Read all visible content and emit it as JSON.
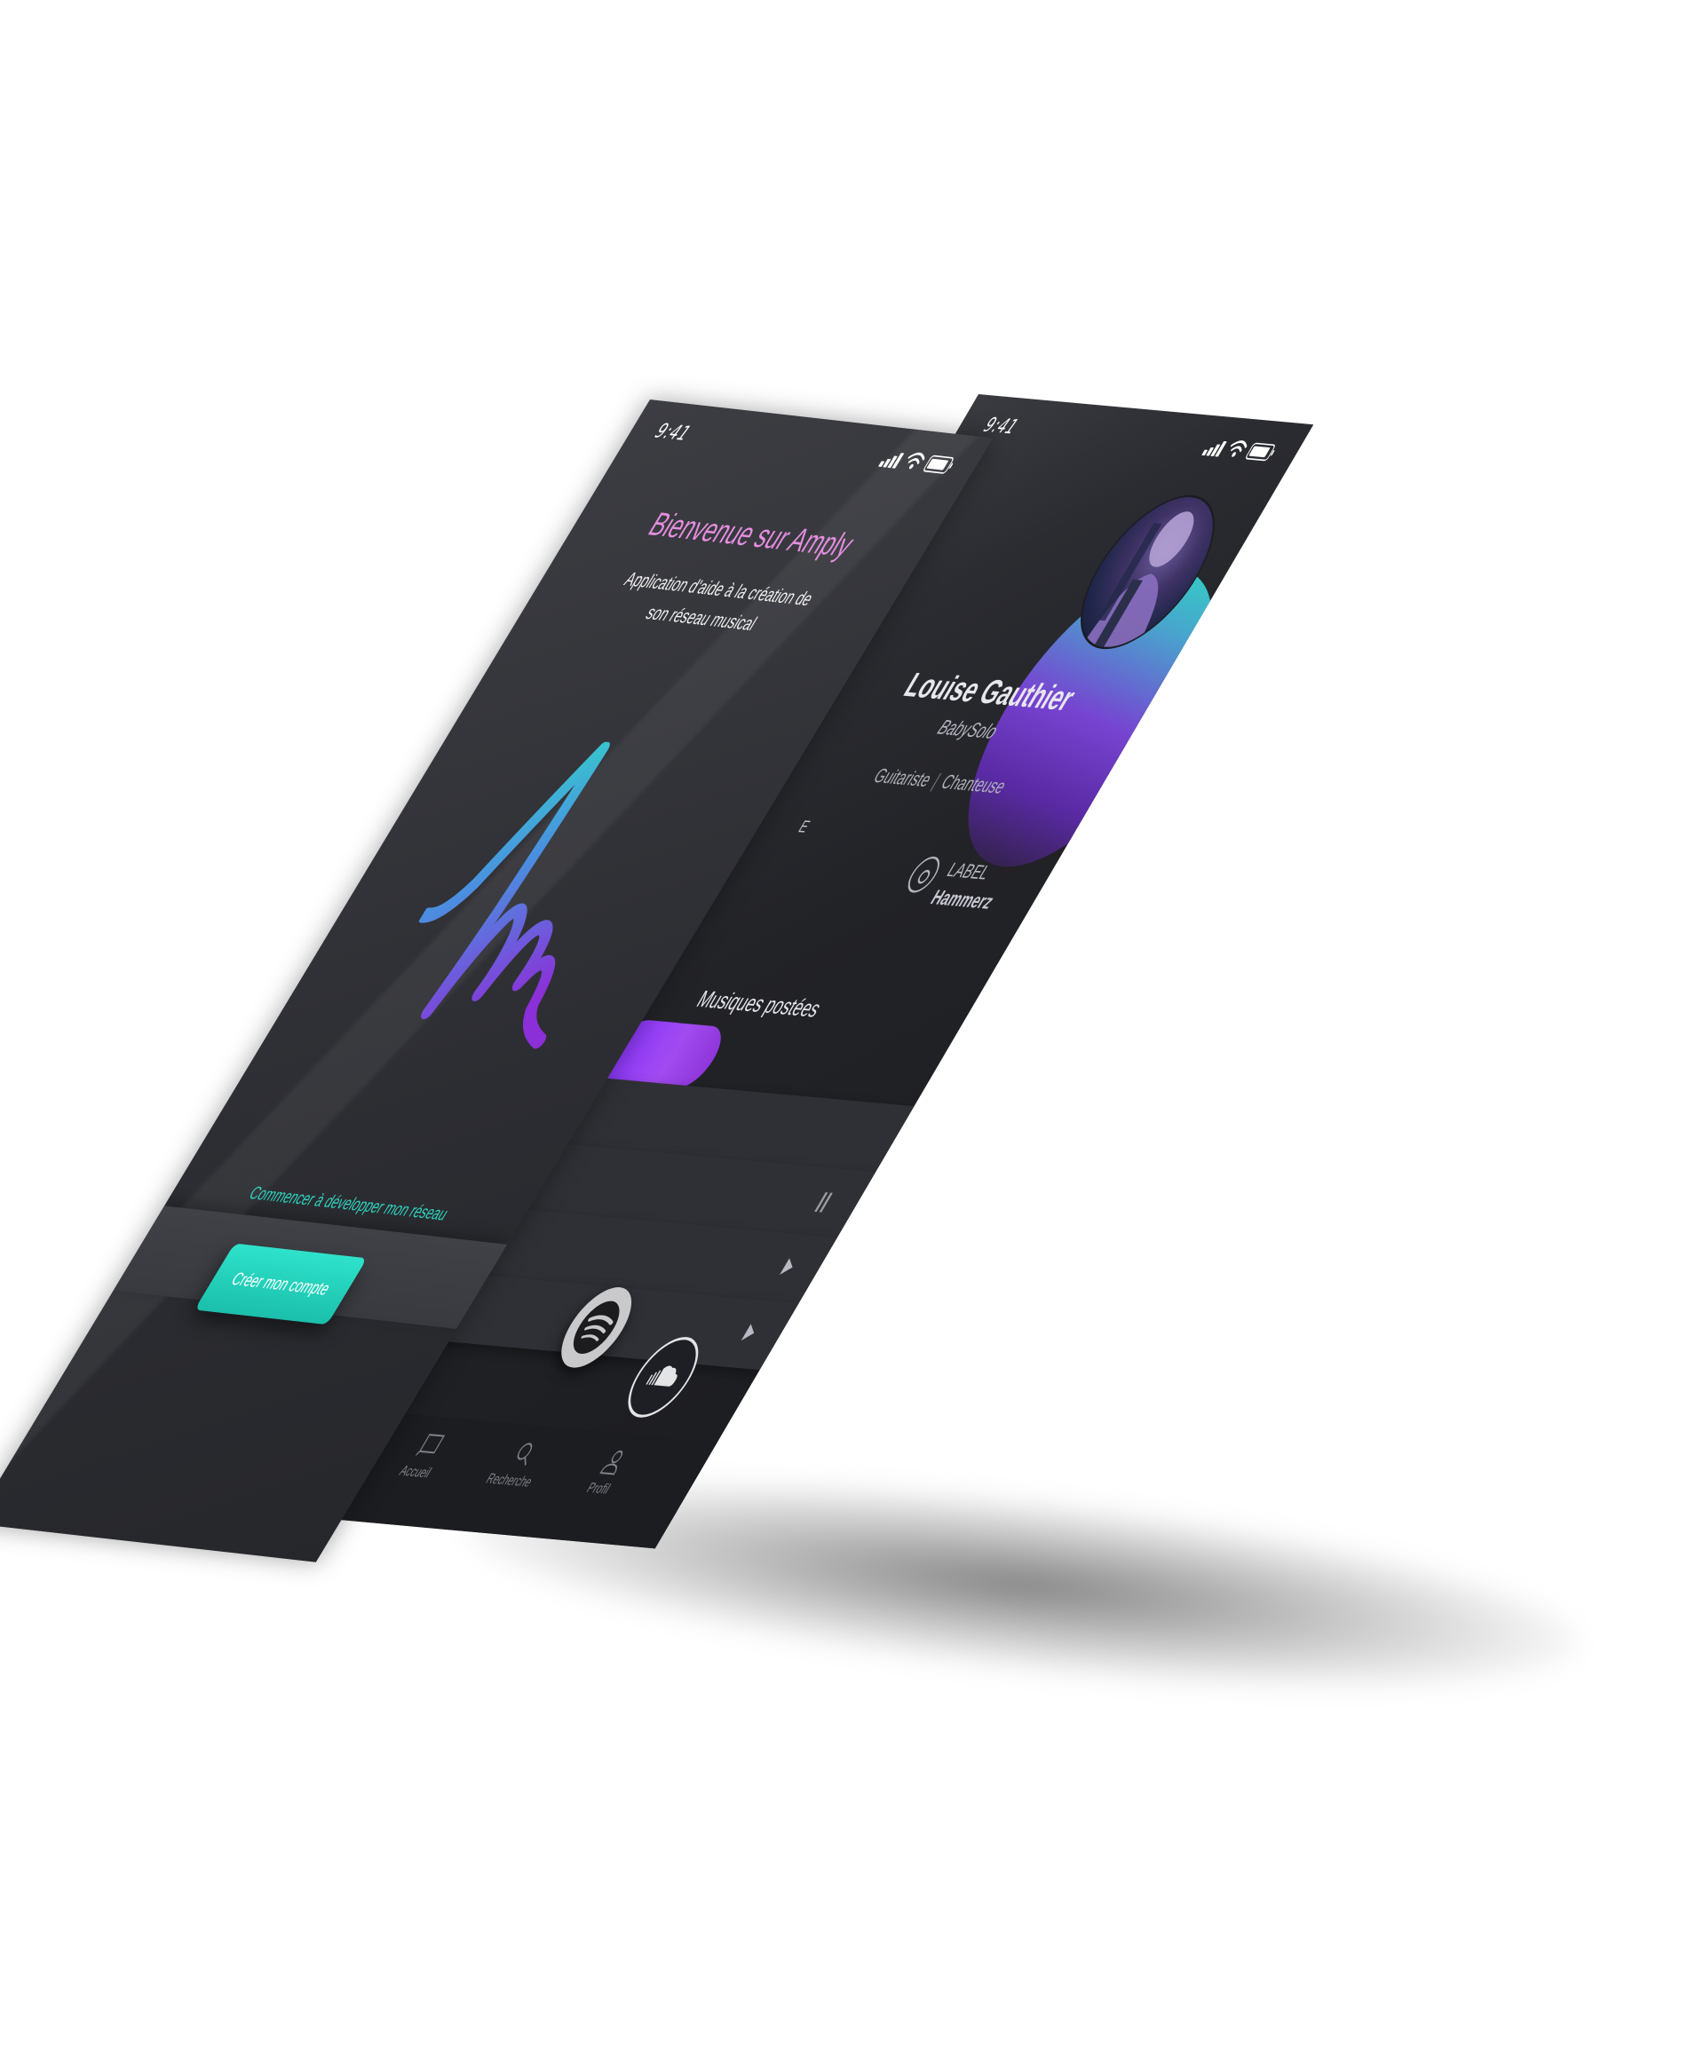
{
  "front_screen": {
    "status": {
      "time": "9:41"
    },
    "welcome": {
      "title": "Bienvenue sur Amply",
      "subtitle": "Application d'aide à la création de son réseau musical"
    },
    "start_text": "Commencer à développer mon réseau",
    "create_account_label": "Créer mon compte"
  },
  "back_screen": {
    "status": {
      "time": "9:41"
    },
    "profile": {
      "name": "Louise Gauthier",
      "alias": "BabySolo",
      "roles": [
        "Guitariste",
        "Chanteuse"
      ],
      "section_letter": "E",
      "label_title": "LABEL",
      "label_value": "Hammerz"
    },
    "tracks_heading": "Musiques postées",
    "track_rows": [
      {
        "control": "pause"
      },
      {
        "control": "play"
      },
      {
        "control": "play"
      }
    ],
    "streaming": [
      {
        "icon": "spotify-icon"
      },
      {
        "icon": "soundcloud-icon"
      }
    ],
    "tabs": [
      {
        "label": "Accueil",
        "icon": "home-icon"
      },
      {
        "label": "Recherche",
        "icon": "search-icon"
      },
      {
        "label": "Profil",
        "icon": "profile-icon"
      }
    ]
  },
  "colors": {
    "brand_pink": "#e58ee0",
    "brand_teal": "#2fd3bf",
    "brand_purple": "#8a35ff",
    "screen_bg": "#2c2d32"
  }
}
